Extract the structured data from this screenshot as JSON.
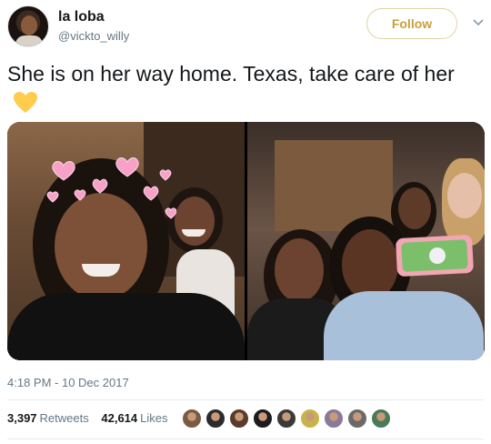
{
  "user": {
    "display_name": "la loba",
    "handle": "@vickto_willy"
  },
  "follow_label": "Follow",
  "tweet": {
    "text": "She is on her way home. Texas, take care of her",
    "emoji": "yellow-heart-icon"
  },
  "timestamp": "4:18 PM - 10 Dec 2017",
  "stats": {
    "retweets_count": "3,397",
    "retweets_label": "Retweets",
    "likes_count": "42,614",
    "likes_label": "Likes"
  },
  "colors": {
    "follow_accent": "#c9a13b",
    "secondary_text": "#657786",
    "heart_emoji": "#ffcc4d",
    "filter_hearts": "#f7a1c8"
  },
  "likers": [
    {
      "color": "#7a5a45"
    },
    {
      "color": "#2c2c2c"
    },
    {
      "color": "#5a3a2a"
    },
    {
      "color": "#1c1c1c"
    },
    {
      "color": "#3a3a3a"
    },
    {
      "color": "#c8b34a"
    },
    {
      "color": "#8a7a9a"
    },
    {
      "color": "#6a6a6a"
    },
    {
      "color": "#4a7a5a"
    }
  ]
}
